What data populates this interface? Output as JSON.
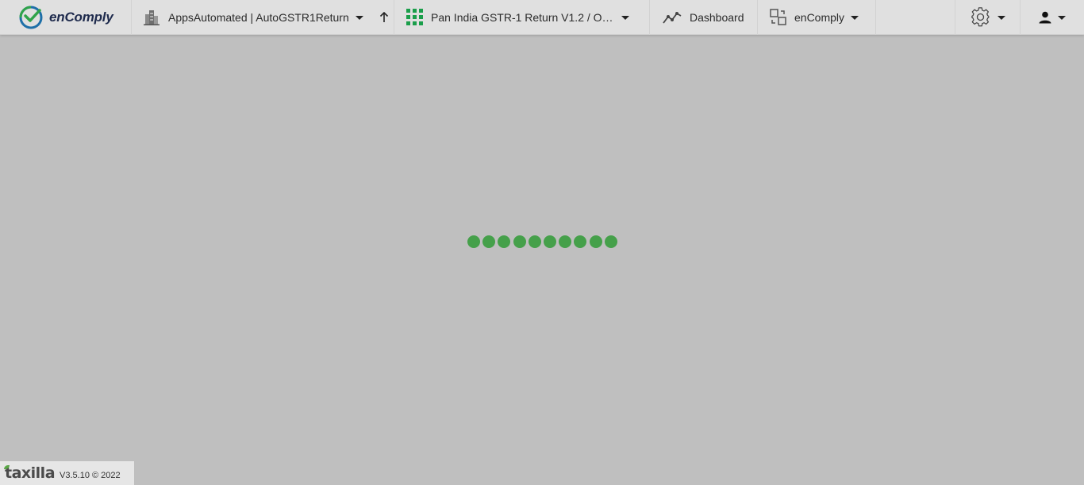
{
  "header": {
    "logo_text": "enComply",
    "org_label": "AppsAutomated | AutoGSTR1Return",
    "app_label": "Pan India GSTR-1 Return V1.2 / Out...",
    "dashboard_label": "Dashboard",
    "product_label": "enComply"
  },
  "loader": {
    "dot_count": 10,
    "color": "#45a04a"
  },
  "footer": {
    "brand": "taxilla",
    "version": "V3.5.10 © 2022"
  },
  "colors": {
    "background": "#bfbfbf",
    "header": "#e0e0e0",
    "accent_green": "#1a9e4a",
    "logo_blue": "#1e6fa8"
  }
}
